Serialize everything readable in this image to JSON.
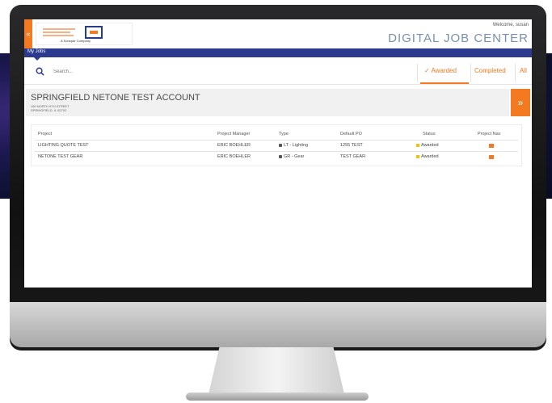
{
  "header": {
    "welcome": "Welcome, susan",
    "app_title": "DIGITAL JOB CENTER",
    "logo_sub": "A Sonepar Company",
    "collapse_glyph": "«"
  },
  "nav": {
    "my_jobs": "My Jobs"
  },
  "search": {
    "placeholder": "Search...",
    "icon": "search-icon"
  },
  "tabs": [
    {
      "label": "✓ Awarded",
      "active": true
    },
    {
      "label": "Completed"
    },
    {
      "label": "All"
    }
  ],
  "account": {
    "name": "SPRINGFIELD NETONE TEST ACCOUNT",
    "address_line1": "150 NORTH 9TH STREET",
    "address_line2": "SPRINGFIELD, IL 62702",
    "arrow": "»"
  },
  "table": {
    "headers": [
      "Project",
      "Project Manager",
      "Type",
      "Default PO",
      "Status",
      "Project Nav"
    ],
    "rows": [
      {
        "project": "LIGHTING QUOTE TEST",
        "manager": "ERIC BOEHLER",
        "type": "LT - Lighting",
        "po": "1255 TEST",
        "status": "Awarded"
      },
      {
        "project": "NETONE TEST GEAR",
        "manager": "ERIC BOEHLER",
        "type": "GR - Gear",
        "po": "TEST GEAR",
        "status": "Awarded"
      }
    ]
  },
  "colors": {
    "accent": "#f47a21",
    "navbar": "#2b3a8f",
    "status": "#f2c200"
  }
}
